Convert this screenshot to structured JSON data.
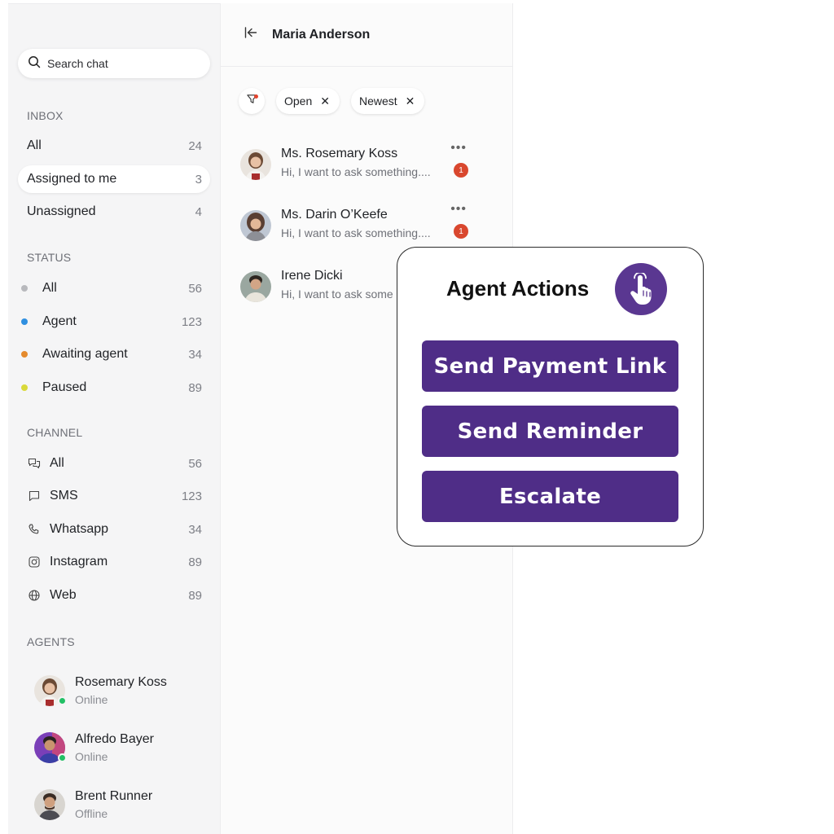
{
  "search": {
    "placeholder": "Search chat"
  },
  "inbox": {
    "title": "INBOX",
    "items": [
      {
        "label": "All",
        "count": "24"
      },
      {
        "label": "Assigned to me",
        "count": "3"
      },
      {
        "label": "Unassigned",
        "count": "4"
      }
    ]
  },
  "status": {
    "title": "STATUS",
    "items": [
      {
        "label": "All",
        "count": "56",
        "color": "#b8b9bd"
      },
      {
        "label": "Agent",
        "count": "123",
        "color": "#2f8fe0"
      },
      {
        "label": "Awaiting agent",
        "count": "34",
        "color": "#e58b2e"
      },
      {
        "label": "Paused",
        "count": "89",
        "color": "#d9d93a"
      }
    ]
  },
  "channel": {
    "title": "CHANNEL",
    "items": [
      {
        "label": "All",
        "count": "56",
        "icon": "chat-bubbles-icon"
      },
      {
        "label": "SMS",
        "count": "123",
        "icon": "message-icon"
      },
      {
        "label": "Whatsapp",
        "count": "34",
        "icon": "phone-icon"
      },
      {
        "label": "Instagram",
        "count": "89",
        "icon": "instagram-icon"
      },
      {
        "label": "Web",
        "count": "89",
        "icon": "globe-icon"
      }
    ]
  },
  "agents": {
    "title": "AGENTS",
    "items": [
      {
        "name": "Rosemary Koss",
        "status": "Online"
      },
      {
        "name": "Alfredo Bayer",
        "status": "Online"
      },
      {
        "name": "Brent Runner",
        "status": "Offline"
      }
    ]
  },
  "panel": {
    "title": "Maria Anderson",
    "filters": [
      {
        "label": "Open"
      },
      {
        "label": "Newest"
      }
    ],
    "conversations": [
      {
        "name": "Ms. Rosemary Koss",
        "preview": "Hi, I want to ask something....",
        "unread": "1"
      },
      {
        "name": "Ms. Darin O’Keefe",
        "preview": "Hi, I want to ask something....",
        "unread": "1"
      },
      {
        "name": "Irene Dicki",
        "preview": "Hi, I want to ask some"
      }
    ]
  },
  "actions": {
    "title": "Agent Actions",
    "buttons": [
      "Send Payment Link",
      "Send Reminder",
      "Escalate"
    ]
  },
  "colors": {
    "accent": "#4f2d87",
    "online": "#22c065",
    "unread": "#d9472e"
  }
}
